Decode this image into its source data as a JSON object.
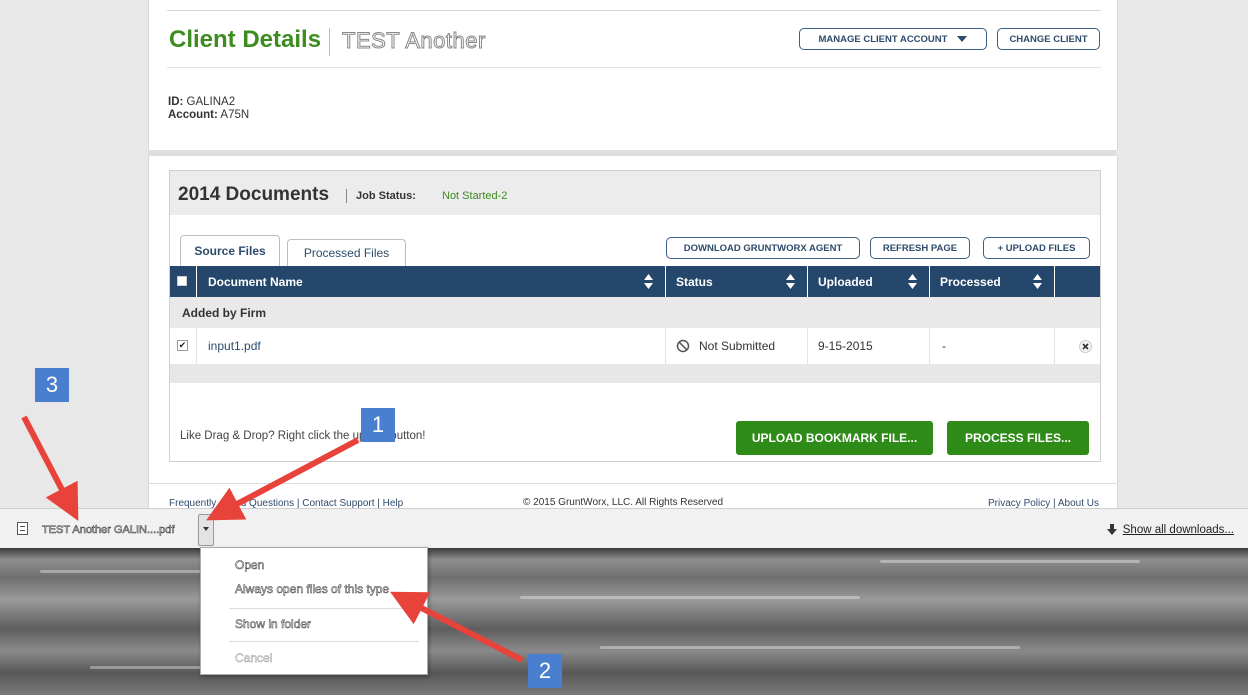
{
  "client": {
    "title": "Client Details",
    "name": "TEST Another",
    "manage_button": "MANAGE CLIENT ACCOUNT",
    "change_button": "CHANGE CLIENT",
    "id_label": "ID:",
    "id_value": "GALINA2",
    "account_label": "Account:",
    "account_value": "A75N"
  },
  "documents": {
    "year_title": "2014  Documents",
    "job_status_label": "Job Status:",
    "job_status_value": "Not Started-2",
    "tabs": [
      {
        "label": "Source Files",
        "active": true
      },
      {
        "label": "Processed Files",
        "active": false
      }
    ],
    "buttons": {
      "download_agent": "DOWNLOAD GRUNTWORX AGENT",
      "refresh": "REFRESH PAGE",
      "upload": "+ UPLOAD FILES"
    },
    "columns": [
      "Document Name",
      "Status",
      "Uploaded",
      "Processed"
    ],
    "group_label": "Added by Firm",
    "rows": [
      {
        "name": "input1.pdf",
        "status": "Not Submitted",
        "uploaded": "9-15-2015",
        "processed": "-",
        "checked": true
      }
    ],
    "hint": "Like Drag & Drop? Right click the upload button!",
    "upload_bookmark": "UPLOAD BOOKMARK FILE...",
    "process_files": "PROCESS FILES..."
  },
  "footer": {
    "left_links": "Frequently Asked Questions | Contact Support | Help",
    "copyright": "© 2015 GruntWorx, LLC. All Rights Reserved",
    "right_links": "Privacy Policy | About Us"
  },
  "download_bar": {
    "file_name": "TEST Another GALIN....pdf",
    "show_all": "Show all downloads..."
  },
  "context_menu": {
    "items": [
      "Open",
      "Always open files of this type",
      "Show in folder",
      "Cancel"
    ]
  },
  "annotations": [
    "1",
    "2",
    "3"
  ],
  "colors": {
    "accent_green": "#3d8c20",
    "header_navy": "#24476b",
    "button_green": "#2e8b18",
    "badge_blue": "#4a7fd0",
    "arrow_red": "#e8433a"
  }
}
